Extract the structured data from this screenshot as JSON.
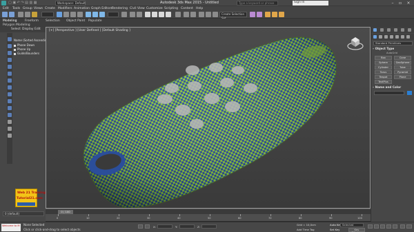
{
  "window": {
    "workspace": "Workspace: Default",
    "file_title": "Autodesk 3ds Max 2015 - Untitled",
    "search_placeholder": "Type a keyword or phrase",
    "sign_in": "Sign In"
  },
  "menus": [
    "Edit",
    "Tools",
    "Group",
    "Views",
    "Create",
    "Modifiers",
    "Animation",
    "Graph Editors",
    "Rendering",
    "Civil View",
    "Customize",
    "Scripting",
    "Content",
    "Help"
  ],
  "toolbar": {
    "selection_set": "Create Selection Set"
  },
  "ribbon": {
    "tabs": [
      "Modeling",
      "Freeform",
      "Selection",
      "Object Paint",
      "Populate"
    ],
    "sub_label": "Polygon Modeling"
  },
  "explorer": {
    "menus": [
      "Select",
      "Display",
      "Edit"
    ],
    "tree": [
      {
        "label": "Name (Sorted Ascending)"
      },
      {
        "label": "Phone Down"
      },
      {
        "label": "Phone Up"
      },
      {
        "label": "Guide/Bounders"
      }
    ],
    "logo_line1": "Web 21 Training",
    "logo_line2": "Tutorial21.com",
    "layer": "0 (default)"
  },
  "viewport": {
    "label": "[+] [Perspective ] [User Defined ] [Default Shading ]"
  },
  "command_panel": {
    "dropdown": "Standard Primitives",
    "object_type_header": "Object Type",
    "autogrid": "AutoGrid",
    "buttons": [
      "Box",
      "Cone",
      "Sphere",
      "GeoSphere",
      "Cylinder",
      "Tube",
      "Torus",
      "Pyramid",
      "Teapot",
      "Plane",
      "TextPlus"
    ],
    "name_color_header": "Name and Color"
  },
  "timeline": {
    "slider": "0 / 100",
    "ticks": [
      "0",
      "10",
      "20",
      "30",
      "40",
      "50",
      "60",
      "70",
      "80",
      "90",
      "100"
    ]
  },
  "status": {
    "maxscript": "Welcome to M",
    "line1": "None Selected",
    "line2": "Click or click-and-drag to select objects",
    "x_label": "X:",
    "y_label": "Y:",
    "z_label": "Z:",
    "grid": "Grid = 10,0cm",
    "add_time_tag": "Add Time Tag",
    "auto_key": "Auto Key",
    "set_key": "Set Key",
    "selected": "Selected",
    "key_filters": "Key Filters..."
  },
  "colors": {
    "mesh_green": "#8cc63f",
    "mesh_blue": "#2b4e9a",
    "button_bg": "#5a5a5a"
  }
}
